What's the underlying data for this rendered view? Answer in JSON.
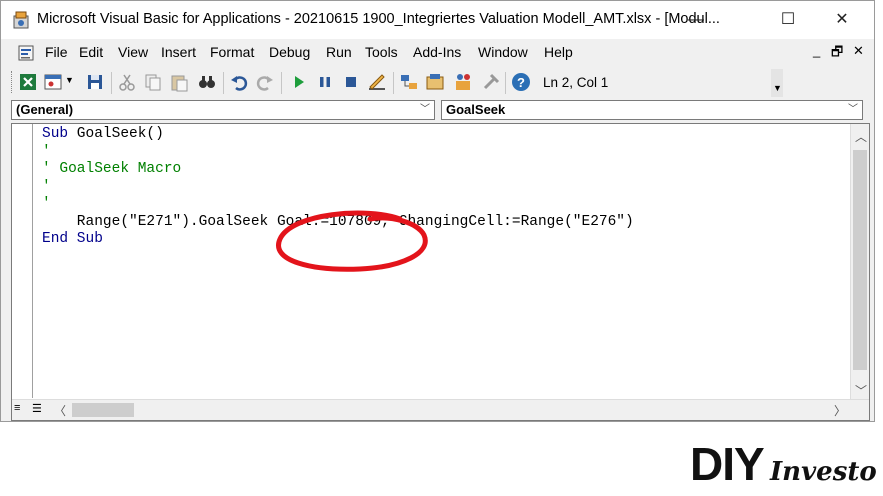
{
  "window": {
    "title": "Microsoft Visual Basic for Applications - 20210615 1900_Integriertes Valuation Modell_AMT.xlsx - [Modul...",
    "controls": {
      "minimize": "—",
      "maximize": "☐",
      "close": "✕"
    }
  },
  "menu": {
    "items": [
      "File",
      "Edit",
      "View",
      "Insert",
      "Format",
      "Debug",
      "Run",
      "Tools",
      "Add-Ins",
      "Window",
      "Help"
    ],
    "mdi_controls": {
      "minimize": "_",
      "restore": "🗗",
      "close": "✕"
    }
  },
  "toolbar": {
    "icons": [
      "view-excel-icon",
      "insert-userform-icon",
      "save-icon",
      "cut-icon",
      "copy-icon",
      "paste-icon",
      "find-icon",
      "undo-icon",
      "redo-icon",
      "run-icon",
      "break-icon",
      "reset-icon",
      "design-mode-icon",
      "project-explorer-icon",
      "properties-icon",
      "object-browser-icon",
      "toolbox-icon",
      "help-icon"
    ],
    "status": "Ln 2, Col 1"
  },
  "combos": {
    "object": "(General)",
    "procedure": "GoalSeek"
  },
  "code": {
    "line1_kw": "Sub",
    "line1_rest": " GoalSeek()",
    "line2": "'",
    "line3": "' GoalSeek Macro",
    "line4": "'",
    "line5": "",
    "line6": "'",
    "line7": "    Range(\"E271\").GoalSeek Goal:=107809, ChangingCell:=Range(\"E276\")",
    "line8_kw": "End Sub"
  },
  "annotation_color": "#e3141b",
  "logo": {
    "main": "DIY",
    "script": "Investor"
  }
}
